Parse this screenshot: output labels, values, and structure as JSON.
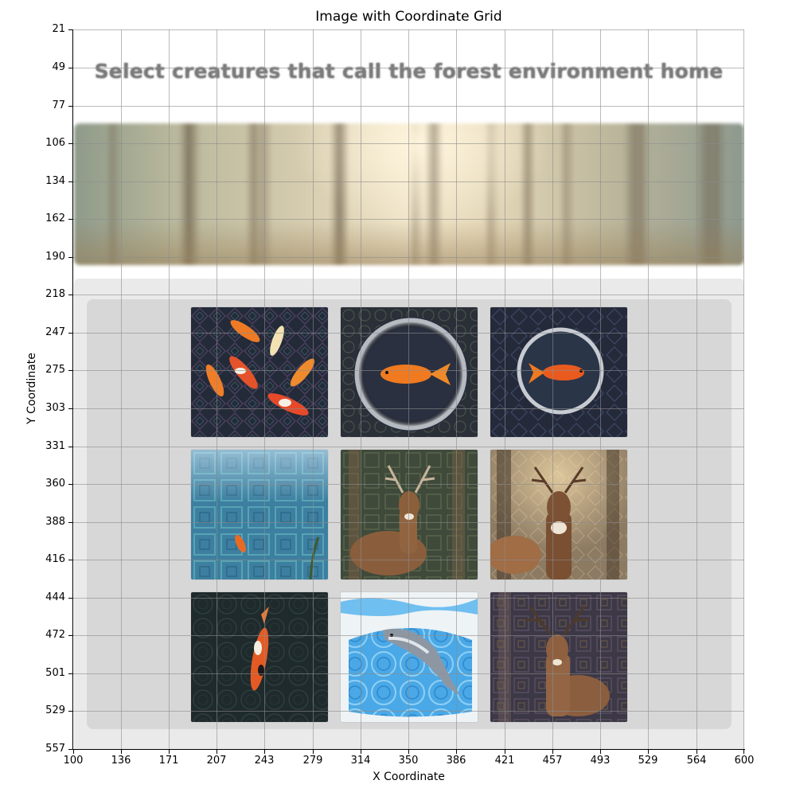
{
  "figure": {
    "title": "Image with Coordinate Grid",
    "xlabel": "X Coordinate",
    "ylabel": "Y Coordinate",
    "x_ticks": [
      "100",
      "136",
      "171",
      "207",
      "243",
      "279",
      "314",
      "350",
      "386",
      "421",
      "457",
      "493",
      "529",
      "564",
      "600"
    ],
    "y_ticks": [
      "21",
      "49",
      "77",
      "106",
      "134",
      "162",
      "190",
      "218",
      "247",
      "275",
      "303",
      "331",
      "360",
      "388",
      "416",
      "444",
      "472",
      "501",
      "529",
      "557"
    ]
  },
  "captcha": {
    "instruction": "Select creatures that call the forest environment home",
    "banner": "forest-scene",
    "tiles": [
      {
        "id": 1,
        "subject": "koi-fish-group"
      },
      {
        "id": 2,
        "subject": "goldfish-in-bowl"
      },
      {
        "id": 3,
        "subject": "goldfish-in-bowl"
      },
      {
        "id": 4,
        "subject": "small-fish-in-water"
      },
      {
        "id": 5,
        "subject": "deer-in-forest"
      },
      {
        "id": 6,
        "subject": "deer-in-forest"
      },
      {
        "id": 7,
        "subject": "koi-fish"
      },
      {
        "id": 8,
        "subject": "dolphin"
      },
      {
        "id": 9,
        "subject": "deer"
      }
    ]
  },
  "colors": {
    "instruction_text": "#7b7b7b",
    "outer_panel": "#eaeaea",
    "inner_panel": "#d7d7d7",
    "grid_line": "#b0b0b0"
  }
}
